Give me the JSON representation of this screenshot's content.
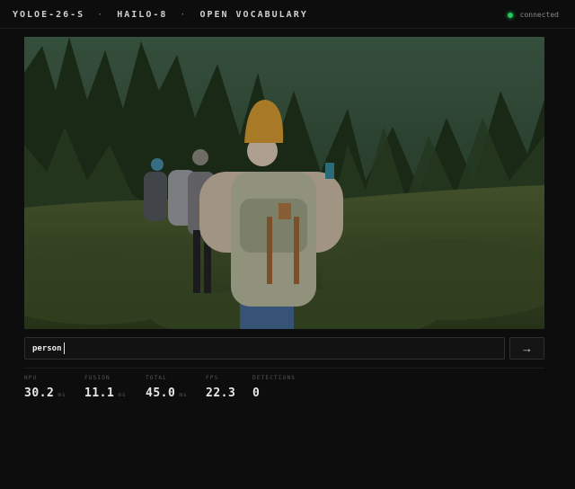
{
  "header": {
    "title_parts": [
      "YOLOE-26-S",
      "HAILO-8",
      "OPEN VOCABULARY"
    ],
    "separator": "·",
    "status_text": "connected",
    "status_color": "#22c55e"
  },
  "video": {
    "description_icon": "video-frame"
  },
  "prompt": {
    "value": "person",
    "send_icon": "arrow-right-icon",
    "send_glyph": "→"
  },
  "stats": {
    "npu": {
      "label": "NPU",
      "value": "30.2",
      "unit": "ms"
    },
    "fusion": {
      "label": "FUSION",
      "value": "11.1",
      "unit": "ms"
    },
    "total": {
      "label": "TOTAL",
      "value": "45.0",
      "unit": "ms"
    },
    "fps": {
      "label": "FPS",
      "value": "22.3"
    },
    "detections": {
      "label": "DETECTIONS",
      "value": "0"
    }
  }
}
